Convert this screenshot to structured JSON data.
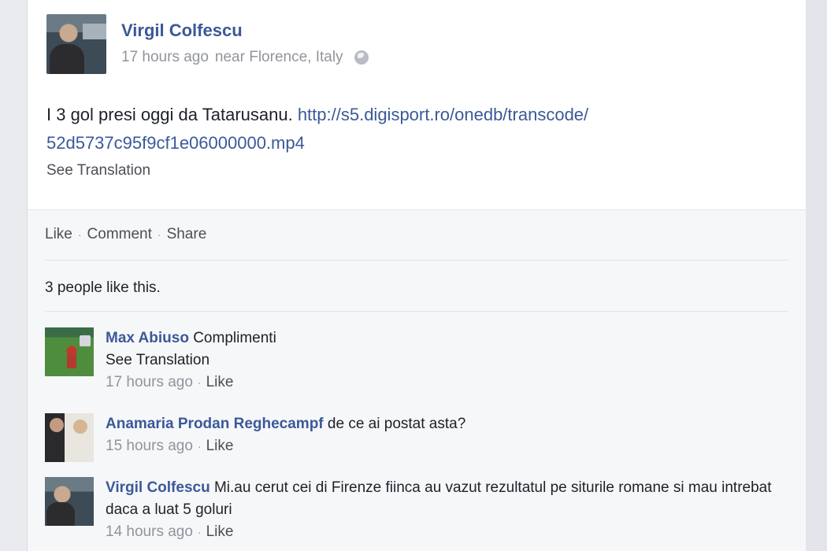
{
  "post": {
    "author": "Virgil Colfescu",
    "time": "17 hours ago",
    "location": "near Florence, Italy",
    "privacy_icon": "globe-icon",
    "text": "I 3 gol presi oggi da Tatarusanu. ",
    "link_line1": "http://s5.digisport.ro/onedb/transcode/",
    "link_line2": "52d5737c95f9cf1e06000000.mp4",
    "see_translation": "See Translation"
  },
  "actions": {
    "like": "Like",
    "comment": "Comment",
    "share": "Share",
    "separator": "·"
  },
  "likes_summary": "3 people like this.",
  "comments": [
    {
      "author": "Max Abiuso",
      "text": "Complimenti",
      "see_translation": "See Translation",
      "time": "17 hours ago",
      "like": "Like"
    },
    {
      "author": "Anamaria Prodan Reghecampf",
      "text": "de ce ai postat asta?",
      "time": "15 hours ago",
      "like": "Like"
    },
    {
      "author": "Virgil Colfescu",
      "text": "Mi.au cerut cei di Firenze fiinca au vazut rezultatul pe siturile romane si mau intrebat daca a luat 5 goluri",
      "time": "14 hours ago",
      "like": "Like"
    }
  ],
  "colors": {
    "name_blue": "#3b5998",
    "meta_gray": "#90949c",
    "feedback_bg": "#f6f7f9"
  }
}
